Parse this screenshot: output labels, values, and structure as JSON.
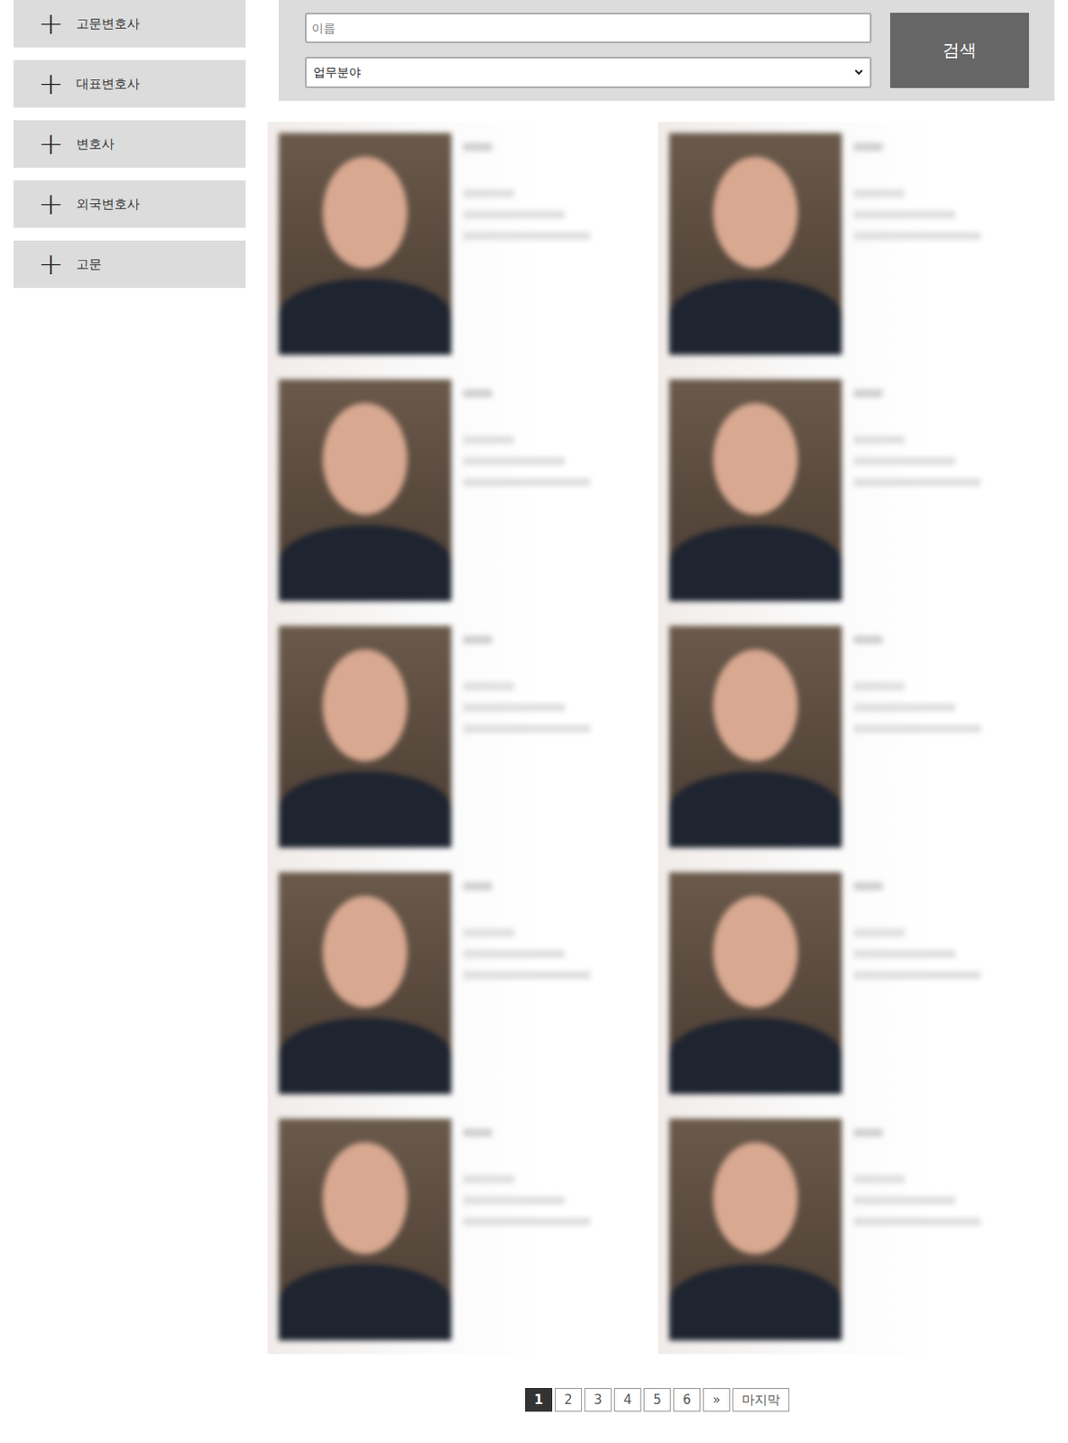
{
  "sidebar": {
    "items": [
      {
        "label": "고문변호사",
        "icon": "+"
      },
      {
        "label": "대표변호사",
        "icon": "+"
      },
      {
        "label": "변호사",
        "icon": "+"
      },
      {
        "label": "외국변호사",
        "icon": "+"
      },
      {
        "label": "고문",
        "icon": "+"
      }
    ]
  },
  "search": {
    "placeholder": "이름",
    "select": "업무분야",
    "button": "검색"
  },
  "profiles": [
    {
      "kind": "lawyer"
    },
    {
      "kind": "lawyer"
    },
    {
      "kind": "lawyer"
    },
    {
      "kind": "lawyer"
    },
    {
      "kind": "lawyer"
    },
    {
      "kind": "lawyer"
    },
    {
      "kind": "lawyer"
    },
    {
      "kind": "lawyer"
    },
    {
      "kind": "lawyer"
    },
    {
      "kind": "lawyer"
    }
  ],
  "pagination": {
    "pages": [
      {
        "label": "1",
        "selected": true
      },
      {
        "label": "2",
        "selected": false
      },
      {
        "label": "3",
        "selected": false
      },
      {
        "label": "4",
        "selected": false
      },
      {
        "label": "5",
        "selected": false
      },
      {
        "label": "6",
        "selected": false
      }
    ],
    "next": "»",
    "last": "마지막"
  }
}
